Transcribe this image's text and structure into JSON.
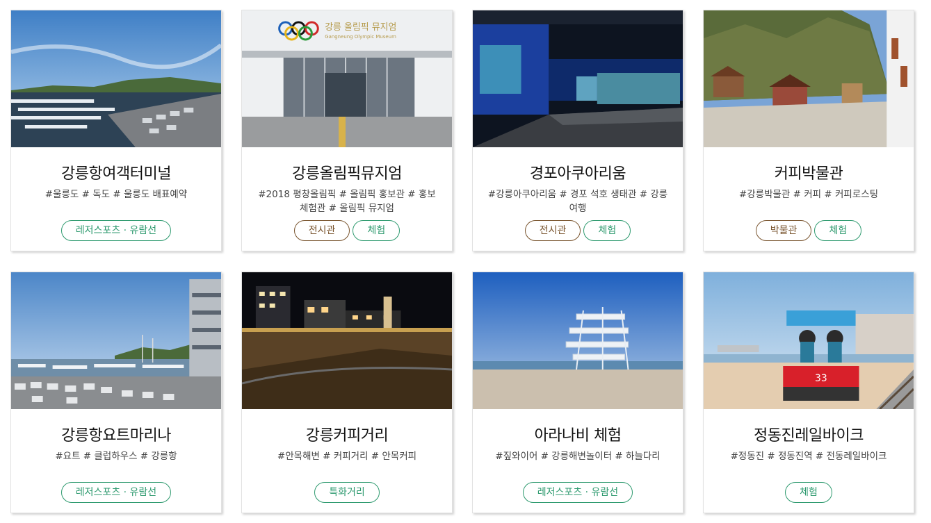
{
  "cards": [
    {
      "title": "강릉항여객터미널",
      "tags": "#울릉도 # 독도 # 울릉도 배표예약",
      "image": "harbor-marina-photo",
      "chips": [
        {
          "label": "레저스포츠 · 유람선",
          "color": "green"
        }
      ]
    },
    {
      "title": "강릉올림픽뮤지엄",
      "tags": "#2018 평창올림픽 # 올림픽 홍보관 # 홍보체험관 # 올림픽 뮤지엄",
      "image": "olympic-museum-entrance-photo",
      "sign_kr": "강릉 올림픽 뮤지엄",
      "sign_en": "Gangneung Olympic Museum",
      "chips": [
        {
          "label": "전시관",
          "color": "brown"
        },
        {
          "label": "체험",
          "color": "green"
        }
      ]
    },
    {
      "title": "경포아쿠아리움",
      "tags": "#강릉아쿠아리움 # 경포 석호 생태관 # 강릉여행",
      "image": "aquarium-interior-photo",
      "chips": [
        {
          "label": "전시관",
          "color": "brown"
        },
        {
          "label": "체험",
          "color": "green"
        }
      ]
    },
    {
      "title": "커피박물관",
      "tags": "#강릉박물관 # 커피 # 커피로스팅",
      "image": "coffee-museum-village-photo",
      "chips": [
        {
          "label": "박물관",
          "color": "brown"
        },
        {
          "label": "체험",
          "color": "green"
        }
      ]
    },
    {
      "title": "강릉항요트마리나",
      "tags": "#요트 # 클럽하우스 # 강릉항",
      "image": "yacht-marina-photo",
      "chips": [
        {
          "label": "레저스포츠 · 유람선",
          "color": "green"
        }
      ]
    },
    {
      "title": "강릉커피거리",
      "tags": "#안목해변 # 커피거리 # 안목커피",
      "image": "coffee-street-night-photo",
      "chips": [
        {
          "label": "특화거리",
          "color": "green"
        }
      ]
    },
    {
      "title": "아라나비 체험",
      "tags": "#짚와이어 # 강릉해변놀이터 # 하늘다리",
      "image": "zipwire-tower-beach-photo",
      "chips": [
        {
          "label": "레저스포츠 · 유람선",
          "color": "green"
        }
      ]
    },
    {
      "title": "정동진레일바이크",
      "tags": "#정동진 # 정동진역 # 전동레일바이크",
      "image": "rail-bike-photo",
      "bike_number": "33",
      "chips": [
        {
          "label": "체험",
          "color": "green"
        }
      ]
    }
  ],
  "colors": {
    "green": "#2e9a6f",
    "brown": "#7a5630"
  }
}
